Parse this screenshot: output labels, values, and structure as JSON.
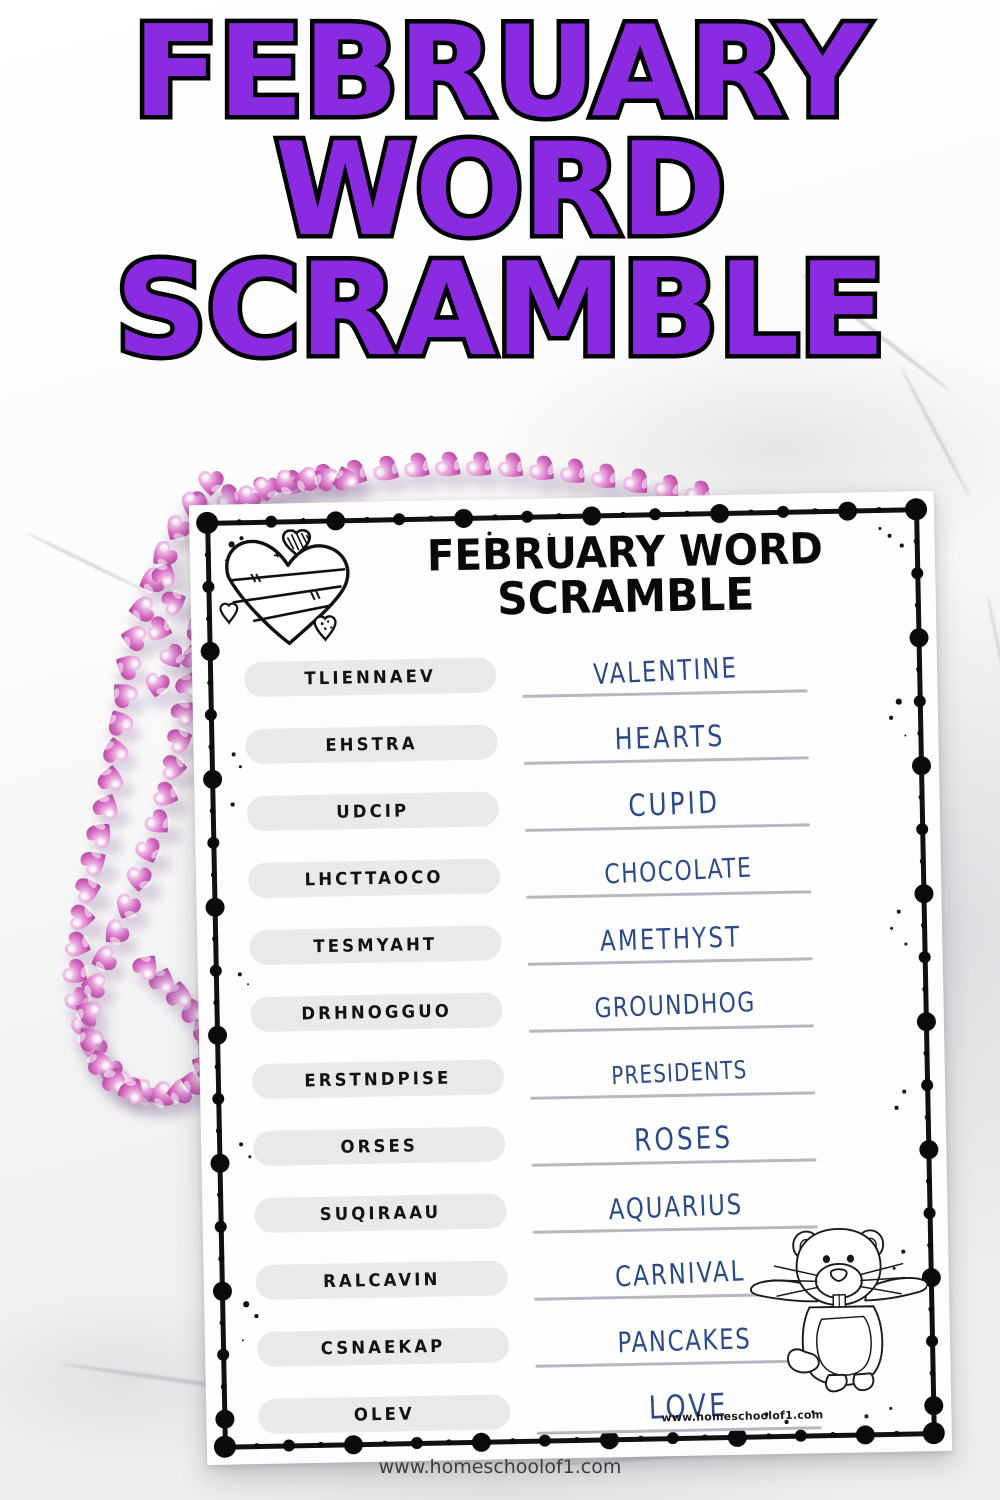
{
  "headline": {
    "line1": "FEBRUARY",
    "line2": "WORD",
    "line3": "SCRAMBLE",
    "color": "#8A2BE2",
    "outline_color": "#000000"
  },
  "worksheet": {
    "title_line1": "FEBRUARY WORD",
    "title_line2": "SCRAMBLE",
    "url": "www.homeschoolof1.com",
    "paper_color": "#fdfdfd",
    "pill_color": "#e9e9e9",
    "line_color": "#b4b9c0",
    "handwriting_color": "#2b4a86",
    "decor": {
      "heart_doodle": "heart-doodle-icon",
      "groundhog": "groundhog-illustration"
    },
    "rows": [
      {
        "scrambled": "TLIENNAEV",
        "answer": "VALENTINE"
      },
      {
        "scrambled": "EHSTRA",
        "answer": "HEARTS"
      },
      {
        "scrambled": "UDCIP",
        "answer": "CUPID"
      },
      {
        "scrambled": "LHCTTAOCO",
        "answer": "CHOCOLATE"
      },
      {
        "scrambled": "TESMYAHT",
        "answer": "AMETHYST"
      },
      {
        "scrambled": "DRHNOGGUO",
        "answer": "GROUNDHOG"
      },
      {
        "scrambled": "ERSTNDPISE",
        "answer": "PRESIDENTS"
      },
      {
        "scrambled": "ORSES",
        "answer": "ROSES"
      },
      {
        "scrambled": "SUQIRAAU",
        "answer": "AQUARIUS"
      },
      {
        "scrambled": "RALCAVIN",
        "answer": "CARNIVAL"
      },
      {
        "scrambled": "CSNAEKAP",
        "answer": "PANCAKES"
      },
      {
        "scrambled": "OLEV",
        "answer": "LOVE"
      }
    ]
  },
  "footer": {
    "url": "www.homeschoolof1.com"
  },
  "props": {
    "beads": "pink-heart-bead-necklace",
    "surface": "white-marble-background"
  }
}
